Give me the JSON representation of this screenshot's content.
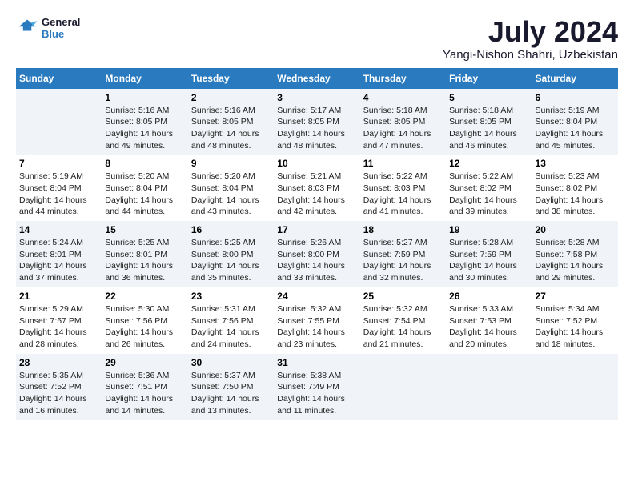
{
  "logo": {
    "line1": "General",
    "line2": "Blue"
  },
  "title": "July 2024",
  "location": "Yangi-Nishon Shahri, Uzbekistan",
  "weekdays": [
    "Sunday",
    "Monday",
    "Tuesday",
    "Wednesday",
    "Thursday",
    "Friday",
    "Saturday"
  ],
  "weeks": [
    [
      {
        "day": "",
        "info": ""
      },
      {
        "day": "1",
        "info": "Sunrise: 5:16 AM\nSunset: 8:05 PM\nDaylight: 14 hours\nand 49 minutes."
      },
      {
        "day": "2",
        "info": "Sunrise: 5:16 AM\nSunset: 8:05 PM\nDaylight: 14 hours\nand 48 minutes."
      },
      {
        "day": "3",
        "info": "Sunrise: 5:17 AM\nSunset: 8:05 PM\nDaylight: 14 hours\nand 48 minutes."
      },
      {
        "day": "4",
        "info": "Sunrise: 5:18 AM\nSunset: 8:05 PM\nDaylight: 14 hours\nand 47 minutes."
      },
      {
        "day": "5",
        "info": "Sunrise: 5:18 AM\nSunset: 8:05 PM\nDaylight: 14 hours\nand 46 minutes."
      },
      {
        "day": "6",
        "info": "Sunrise: 5:19 AM\nSunset: 8:04 PM\nDaylight: 14 hours\nand 45 minutes."
      }
    ],
    [
      {
        "day": "7",
        "info": "Sunrise: 5:19 AM\nSunset: 8:04 PM\nDaylight: 14 hours\nand 44 minutes."
      },
      {
        "day": "8",
        "info": "Sunrise: 5:20 AM\nSunset: 8:04 PM\nDaylight: 14 hours\nand 44 minutes."
      },
      {
        "day": "9",
        "info": "Sunrise: 5:20 AM\nSunset: 8:04 PM\nDaylight: 14 hours\nand 43 minutes."
      },
      {
        "day": "10",
        "info": "Sunrise: 5:21 AM\nSunset: 8:03 PM\nDaylight: 14 hours\nand 42 minutes."
      },
      {
        "day": "11",
        "info": "Sunrise: 5:22 AM\nSunset: 8:03 PM\nDaylight: 14 hours\nand 41 minutes."
      },
      {
        "day": "12",
        "info": "Sunrise: 5:22 AM\nSunset: 8:02 PM\nDaylight: 14 hours\nand 39 minutes."
      },
      {
        "day": "13",
        "info": "Sunrise: 5:23 AM\nSunset: 8:02 PM\nDaylight: 14 hours\nand 38 minutes."
      }
    ],
    [
      {
        "day": "14",
        "info": "Sunrise: 5:24 AM\nSunset: 8:01 PM\nDaylight: 14 hours\nand 37 minutes."
      },
      {
        "day": "15",
        "info": "Sunrise: 5:25 AM\nSunset: 8:01 PM\nDaylight: 14 hours\nand 36 minutes."
      },
      {
        "day": "16",
        "info": "Sunrise: 5:25 AM\nSunset: 8:00 PM\nDaylight: 14 hours\nand 35 minutes."
      },
      {
        "day": "17",
        "info": "Sunrise: 5:26 AM\nSunset: 8:00 PM\nDaylight: 14 hours\nand 33 minutes."
      },
      {
        "day": "18",
        "info": "Sunrise: 5:27 AM\nSunset: 7:59 PM\nDaylight: 14 hours\nand 32 minutes."
      },
      {
        "day": "19",
        "info": "Sunrise: 5:28 AM\nSunset: 7:59 PM\nDaylight: 14 hours\nand 30 minutes."
      },
      {
        "day": "20",
        "info": "Sunrise: 5:28 AM\nSunset: 7:58 PM\nDaylight: 14 hours\nand 29 minutes."
      }
    ],
    [
      {
        "day": "21",
        "info": "Sunrise: 5:29 AM\nSunset: 7:57 PM\nDaylight: 14 hours\nand 28 minutes."
      },
      {
        "day": "22",
        "info": "Sunrise: 5:30 AM\nSunset: 7:56 PM\nDaylight: 14 hours\nand 26 minutes."
      },
      {
        "day": "23",
        "info": "Sunrise: 5:31 AM\nSunset: 7:56 PM\nDaylight: 14 hours\nand 24 minutes."
      },
      {
        "day": "24",
        "info": "Sunrise: 5:32 AM\nSunset: 7:55 PM\nDaylight: 14 hours\nand 23 minutes."
      },
      {
        "day": "25",
        "info": "Sunrise: 5:32 AM\nSunset: 7:54 PM\nDaylight: 14 hours\nand 21 minutes."
      },
      {
        "day": "26",
        "info": "Sunrise: 5:33 AM\nSunset: 7:53 PM\nDaylight: 14 hours\nand 20 minutes."
      },
      {
        "day": "27",
        "info": "Sunrise: 5:34 AM\nSunset: 7:52 PM\nDaylight: 14 hours\nand 18 minutes."
      }
    ],
    [
      {
        "day": "28",
        "info": "Sunrise: 5:35 AM\nSunset: 7:52 PM\nDaylight: 14 hours\nand 16 minutes."
      },
      {
        "day": "29",
        "info": "Sunrise: 5:36 AM\nSunset: 7:51 PM\nDaylight: 14 hours\nand 14 minutes."
      },
      {
        "day": "30",
        "info": "Sunrise: 5:37 AM\nSunset: 7:50 PM\nDaylight: 14 hours\nand 13 minutes."
      },
      {
        "day": "31",
        "info": "Sunrise: 5:38 AM\nSunset: 7:49 PM\nDaylight: 14 hours\nand 11 minutes."
      },
      {
        "day": "",
        "info": ""
      },
      {
        "day": "",
        "info": ""
      },
      {
        "day": "",
        "info": ""
      }
    ]
  ]
}
